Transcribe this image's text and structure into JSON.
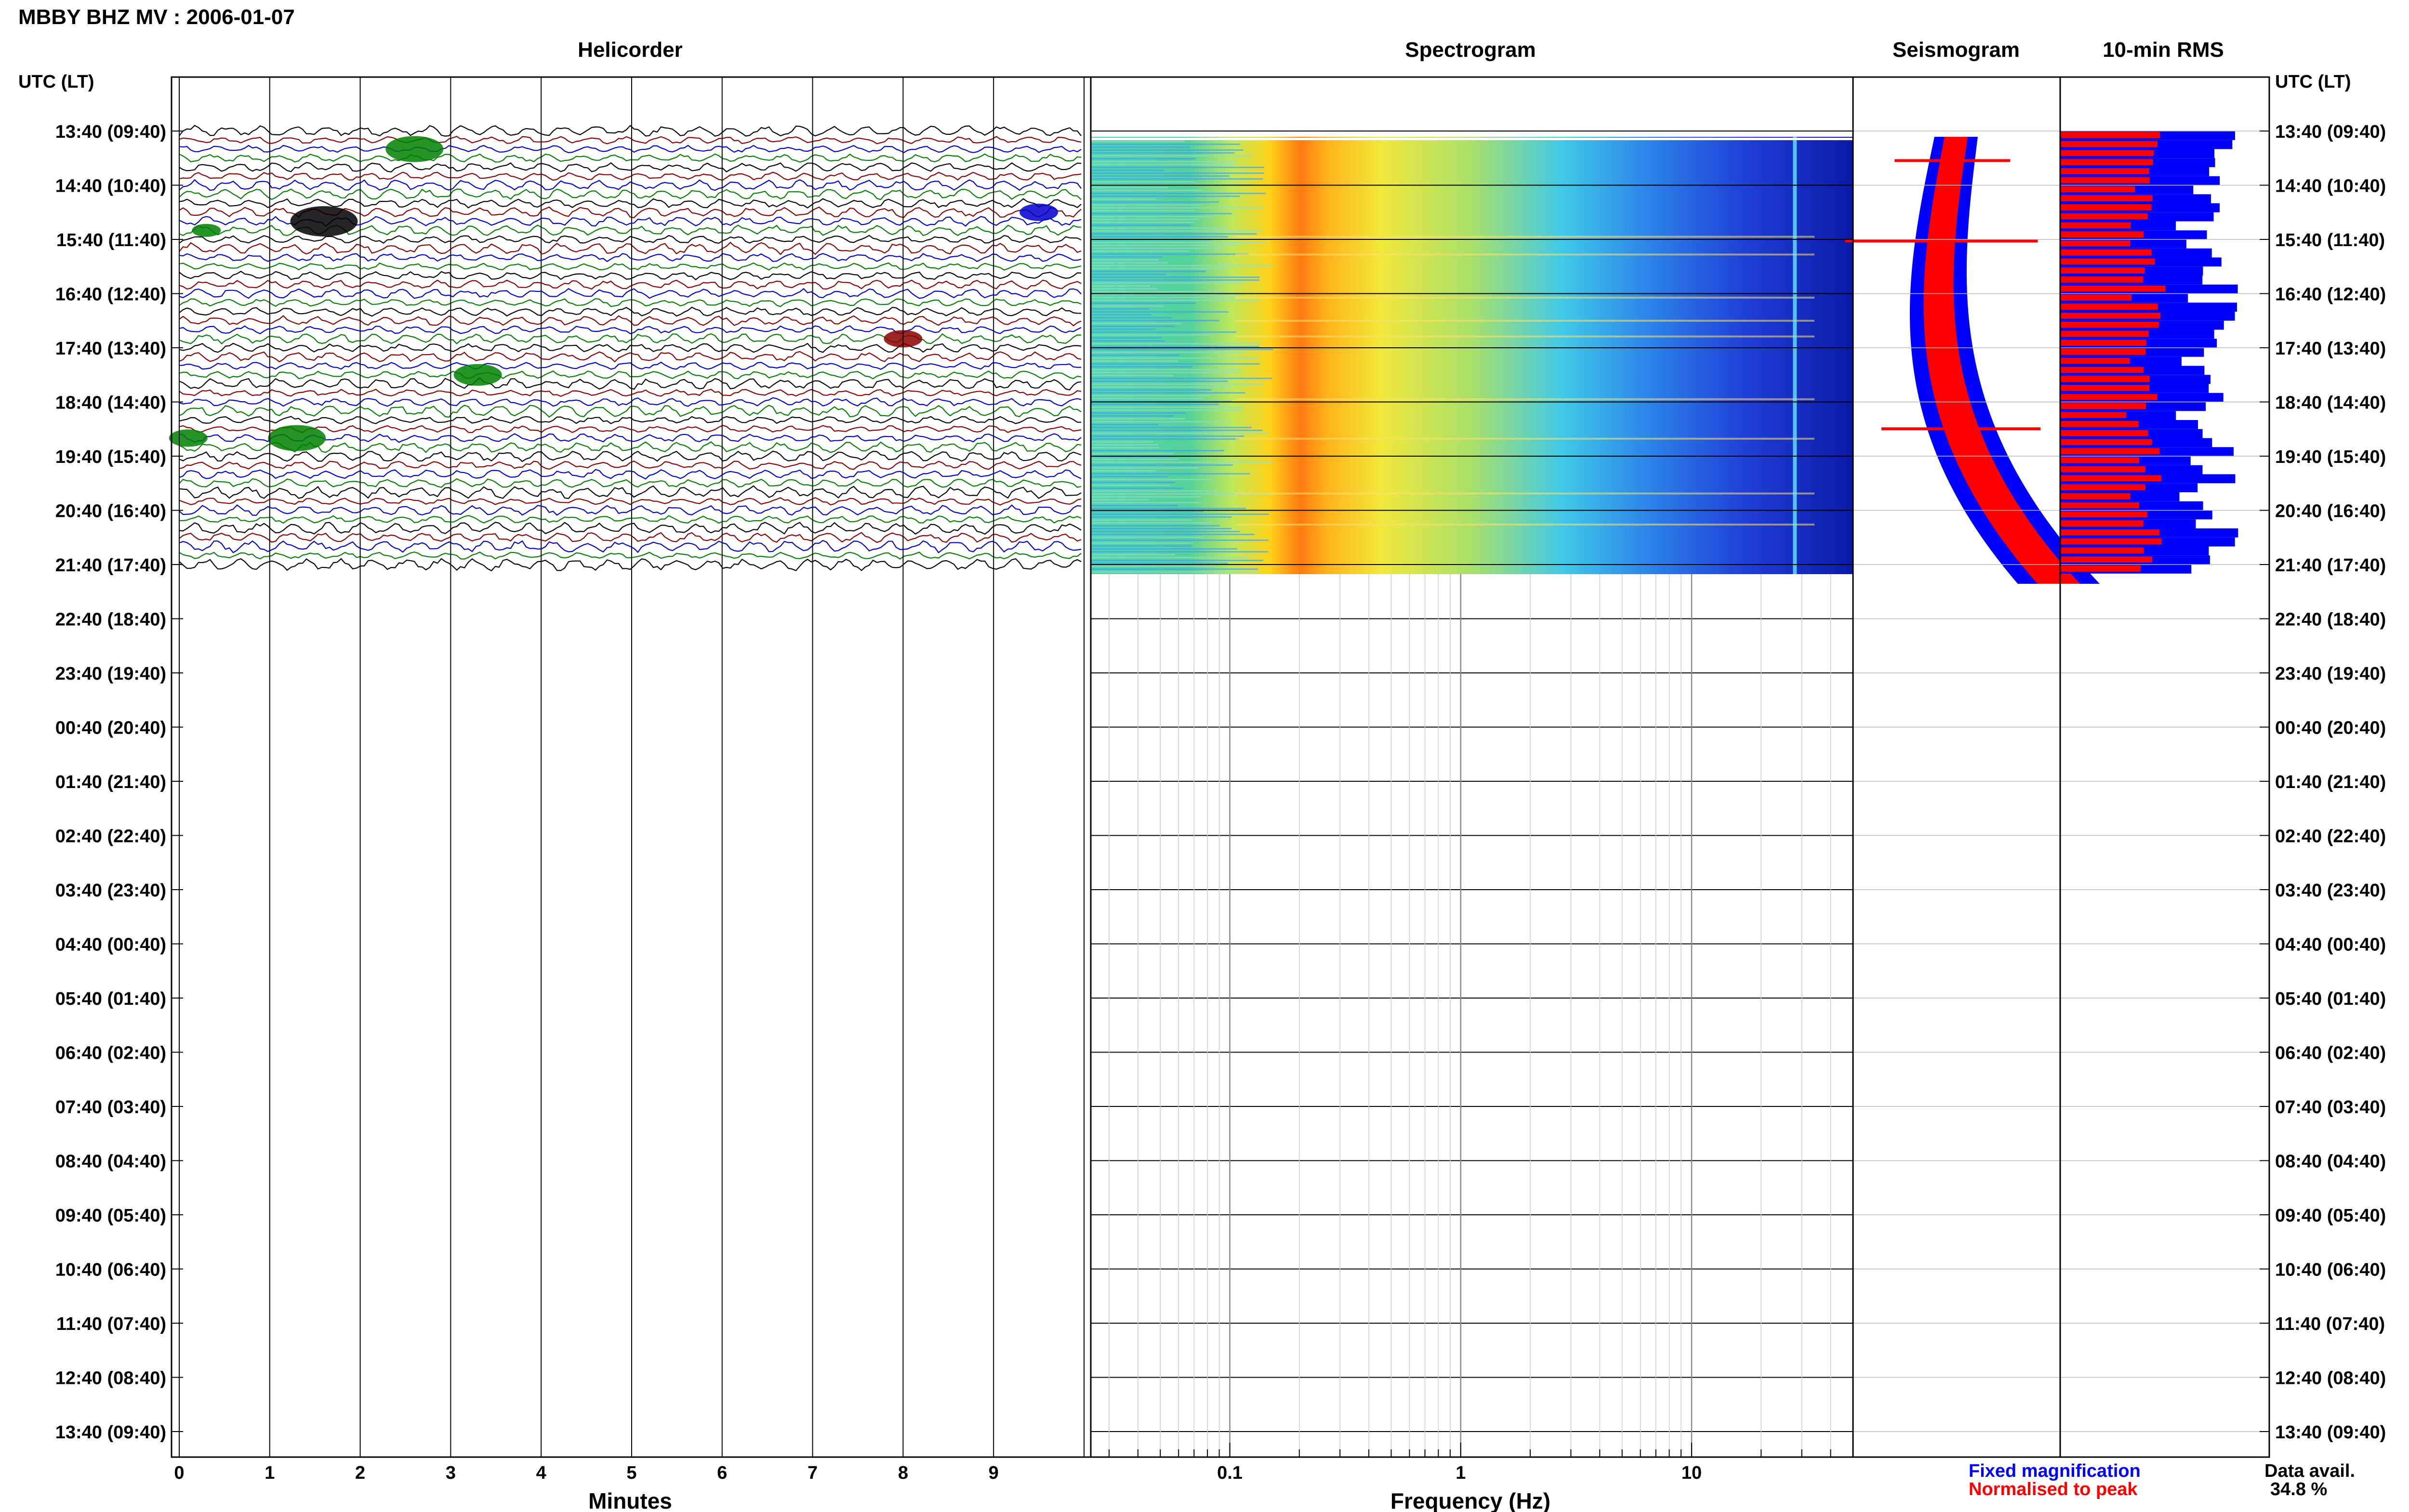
{
  "page": {
    "title": "MBBY BHZ MV : 2006-01-07"
  },
  "panels": {
    "helicorder": "Helicorder",
    "spectrogram": "Spectrogram",
    "seismogram": "Seismogram",
    "rms": "10-min RMS"
  },
  "axes": {
    "left_header": "UTC (LT)",
    "right_header": "UTC (LT)",
    "helicorder_xlabel": "Minutes",
    "spectrogram_xlabel": "Frequency (Hz)",
    "minute_ticks": [
      "0",
      "1",
      "2",
      "3",
      "4",
      "5",
      "6",
      "7",
      "8",
      "9"
    ],
    "frequency_ticks": [
      "0.1",
      "1",
      "10"
    ],
    "time_labels": [
      "13:40 (09:40)",
      "14:40 (10:40)",
      "15:40 (11:40)",
      "16:40 (12:40)",
      "17:40 (13:40)",
      "18:40 (14:40)",
      "19:40 (15:40)",
      "20:40 (16:40)",
      "21:40 (17:40)",
      "22:40 (18:40)",
      "23:40 (19:40)",
      "00:40 (20:40)",
      "01:40 (21:40)",
      "02:40 (22:40)",
      "03:40 (23:40)",
      "04:40 (00:40)",
      "05:40 (01:40)",
      "06:40 (02:40)",
      "07:40 (03:40)",
      "08:40 (04:40)",
      "09:40 (05:40)",
      "10:40 (06:40)",
      "11:40 (07:40)",
      "12:40 (08:40)",
      "13:40 (09:40)"
    ]
  },
  "legend": {
    "fixed": "Fixed magnification",
    "normalised": "Normalised to peak",
    "fixed_color": "#0000ff",
    "normalised_color": "#ff0000"
  },
  "availability": {
    "label": "Data avail.",
    "value": "34.8 %"
  },
  "colors": {
    "trace_cycle": [
      "#000000",
      "#8b0000",
      "#0000cd",
      "#008000"
    ],
    "rms_fixed": "#0000ff",
    "rms_normalised": "#ff0000"
  },
  "chart_data": {
    "type": "heatmap",
    "title": "MBBY BHZ MV : 2006-01-07",
    "helicorder": {
      "minutes_per_line": 10,
      "x_range_minutes": [
        0,
        10
      ],
      "lines_with_data": 49,
      "time_axis_hours": 24,
      "start_utc": "13:40"
    },
    "spectrogram": {
      "x_scale": "log",
      "x_range_hz": [
        0.025,
        50
      ],
      "dominant_band_hz": [
        0.15,
        0.35
      ],
      "persistent_line_hz": 28
    },
    "rms_10min": {
      "normalised_fraction_of_fixed": 0.55
    }
  }
}
